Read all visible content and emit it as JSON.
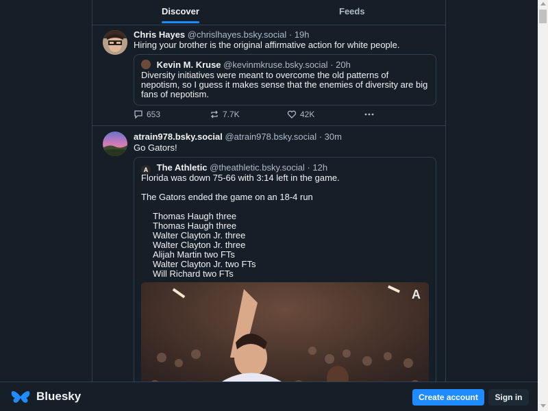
{
  "tabs": {
    "discover": "Discover",
    "feeds": "Feeds"
  },
  "posts": [
    {
      "author_name": "Chris Hayes",
      "author_handle": "@chrislhayes.bsky.social",
      "time": "· 19h",
      "text": "Hiring your brother is the original affirmative action for white people.",
      "quote": {
        "author_name": "Kevin M. Kruse",
        "author_handle": "@kevinmkruse.bsky.social",
        "time": "· 20h",
        "text": "Diversity initiatives were meant to overcome the old patterns of nepotism, so I guess it makes sense that the enemies of diversity are big fans of nepotism."
      },
      "actions": {
        "replies": "653",
        "reposts": "7.7K",
        "likes": "42K"
      }
    },
    {
      "author_name": "atrain978.bsky.social",
      "author_handle": "@atrain978.bsky.social",
      "time": "· 30m",
      "text": "Go Gators!",
      "quote": {
        "author_name": "The Athletic",
        "author_handle": "@theathletic.bsky.social",
        "time": "· 12h",
        "line1": "Florida was down 75-66 with 3:14 left in the game.",
        "line2": "The Gators ended the game on an 18-4 run",
        "list": [
          "Thomas Haugh three",
          "Thomas Haugh three",
          "Walter Clayton Jr. three",
          "Walter Clayton Jr. three",
          "Alijah Martin two FTs",
          "Walter Clayton Jr. two FTs",
          "Will Richard two FTs"
        ],
        "image_badge": "A"
      }
    }
  ],
  "footer": {
    "brand": "Bluesky",
    "create_account": "Create account",
    "sign_in": "Sign in"
  },
  "colors": {
    "accent": "#208bfe",
    "background": "#161e27",
    "border": "#2e4052",
    "muted": "#aebbc9"
  },
  "icons": {
    "reply": "speech-bubble-icon",
    "repost": "repost-arrows-icon",
    "like": "heart-icon",
    "more": "more-dots-icon",
    "logo": "butterfly-icon"
  }
}
